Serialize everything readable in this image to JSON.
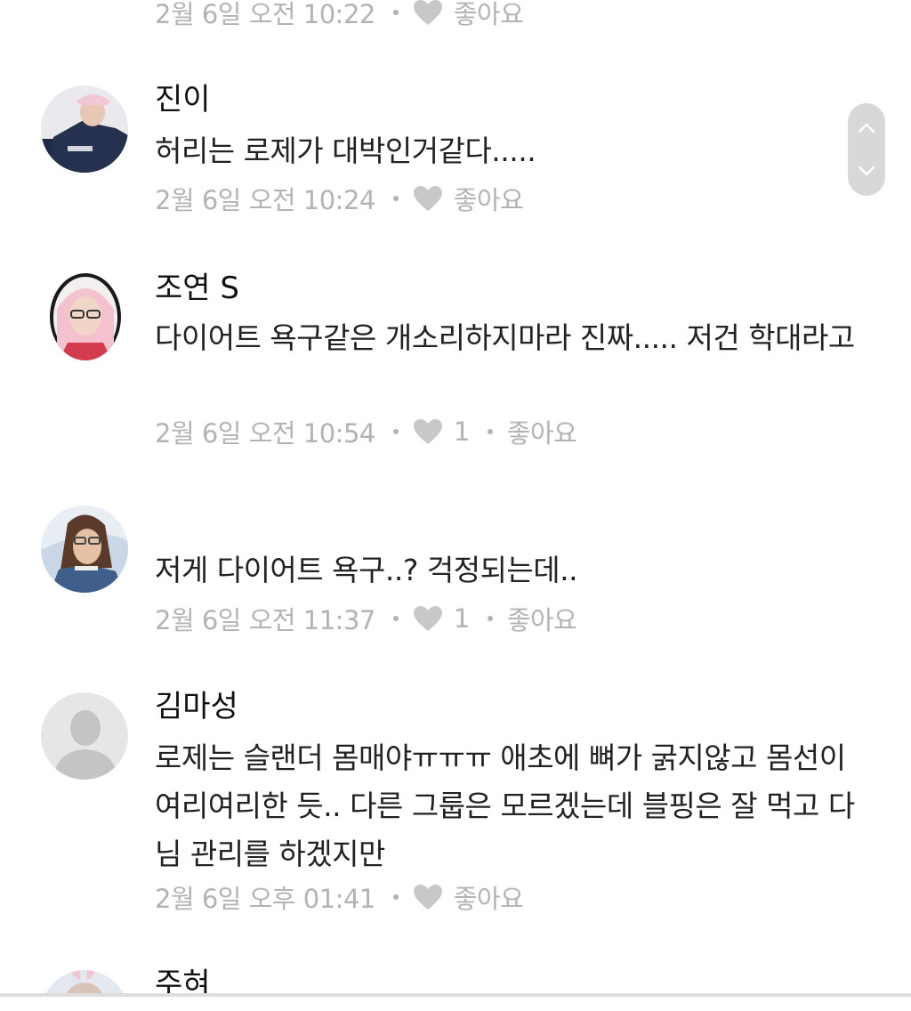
{
  "top_meta": {
    "time": "2월 6일 오전 10:22",
    "like_label": "좋아요"
  },
  "comments": [
    {
      "author": "진이",
      "body": "허리는 로제가 대박인거같다.....",
      "time": "2월 6일 오전 10:24",
      "like_count": "",
      "like_label": "좋아요"
    },
    {
      "author": "조연 S",
      "body": "다이어트 욕구같은 개소리하지마라 진짜..... 저건 학대라고",
      "time": "2월 6일 오전 10:54",
      "like_count": "1",
      "like_label": "좋아요"
    },
    {
      "author": "",
      "body": "저게 다이어트 욕구..? 걱정되는데..",
      "time": "2월 6일 오전 11:37",
      "like_count": "1",
      "like_label": "좋아요"
    },
    {
      "author": "김마성",
      "body": "로제는 슬랜더 몸매야ㅠㅠㅠ 애초에 뼈가 굵지않고 몸선이 여리여리한 듯.. 다른 그룹은 모르겠는데 블핑은 잘 먹고 다님 관리를 하겠지만",
      "time": "2월 6일 오후 01:41",
      "like_count": "",
      "like_label": "좋아요"
    },
    {
      "author": "주혀",
      "body": "",
      "time": "",
      "like_count": "",
      "like_label": ""
    }
  ],
  "colors": {
    "meta_gray": "#b3b3b3",
    "author_text": "#111111",
    "body_text": "#222222",
    "scroll_nav_bg": "#d8d8d8"
  },
  "icons": {
    "like": "heart-icon",
    "scroll_up": "chevron-up-icon",
    "scroll_down": "chevron-down-icon"
  }
}
